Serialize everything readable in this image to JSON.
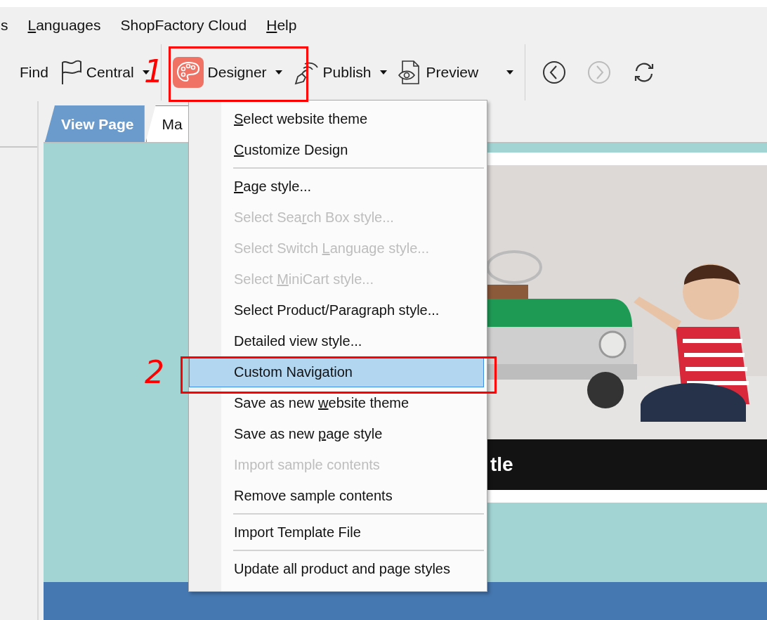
{
  "menu_bar": [
    {
      "label": {
        "before": "s"
      }
    },
    {
      "label": {
        "key": "L",
        "after": "anguages"
      }
    },
    {
      "label": {
        "before": "ShopFactory Cloud"
      }
    },
    {
      "label": {
        "key": "H",
        "after": "elp"
      }
    }
  ],
  "toolbar": [
    {
      "kind": "text",
      "label": "Find",
      "disabled": false
    },
    {
      "kind": "flag",
      "label": "Central",
      "caret": true,
      "disabled": false
    },
    {
      "kind": "separator"
    },
    {
      "kind": "palette",
      "label": "Designer",
      "caret": true,
      "disabled": false
    },
    {
      "kind": "signal",
      "label": "Publish",
      "caret": true,
      "disabled": false
    },
    {
      "kind": "eye",
      "label": "Preview",
      "caret": true,
      "disabled": false
    },
    {
      "kind": "separator"
    },
    {
      "kind": "back",
      "disabled": false
    },
    {
      "kind": "forward",
      "disabled": true
    },
    {
      "kind": "refresh",
      "disabled": false
    }
  ],
  "tabs": [
    {
      "label": "View Page",
      "selected": true
    },
    {
      "label": "Ma",
      "selected": false
    }
  ],
  "banner": {
    "kind": "picture",
    "caption": "tle"
  },
  "dropdown_menu": [
    {
      "kind": "item",
      "label": {
        "key": "S",
        "after": "elect website theme"
      },
      "disabled": false,
      "selected": false
    },
    {
      "kind": "item",
      "label": {
        "key": "C",
        "after": "ustomize Design"
      },
      "disabled": false,
      "selected": false
    },
    {
      "kind": "separator"
    },
    {
      "kind": "item",
      "label": {
        "key": "P",
        "after": "age style..."
      },
      "disabled": false,
      "selected": false
    },
    {
      "kind": "item",
      "label": {
        "before": "Select Sea",
        "key": "r",
        "after": "ch Box style..."
      },
      "disabled": true,
      "selected": false
    },
    {
      "kind": "item",
      "label": {
        "before": "Select Switch ",
        "key": "L",
        "after": "anguage style..."
      },
      "disabled": true,
      "selected": false
    },
    {
      "kind": "item",
      "label": {
        "before": "Select ",
        "key": "M",
        "after": "iniCart style..."
      },
      "disabled": true,
      "selected": false
    },
    {
      "kind": "item",
      "label": {
        "before": "Select Product/Paragraph style..."
      },
      "disabled": false,
      "selected": false
    },
    {
      "kind": "item",
      "label": {
        "before": "Detailed view style..."
      },
      "disabled": false,
      "selected": false
    },
    {
      "kind": "item",
      "label": {
        "before": "Custom Navigation"
      },
      "disabled": false,
      "selected": true
    },
    {
      "kind": "item",
      "label": {
        "before": "Save as new ",
        "key": "w",
        "after": "ebsite theme"
      },
      "disabled": false,
      "selected": false
    },
    {
      "kind": "item",
      "label": {
        "before": "Save as new ",
        "key": "p",
        "after": "age style"
      },
      "disabled": false,
      "selected": false
    },
    {
      "kind": "item",
      "label": {
        "before": "Import sample contents"
      },
      "disabled": true,
      "selected": false
    },
    {
      "kind": "item",
      "label": {
        "before": "Remove sample contents"
      },
      "disabled": false,
      "selected": false
    },
    {
      "kind": "separator"
    },
    {
      "kind": "item",
      "label": {
        "before": "Import Template File"
      },
      "disabled": false,
      "selected": false
    },
    {
      "kind": "separator"
    },
    {
      "kind": "item",
      "label": {
        "before": "Update all product and page styles"
      },
      "disabled": false,
      "selected": false
    }
  ],
  "annotations": [
    {
      "number": "1"
    },
    {
      "number": "2"
    }
  ]
}
